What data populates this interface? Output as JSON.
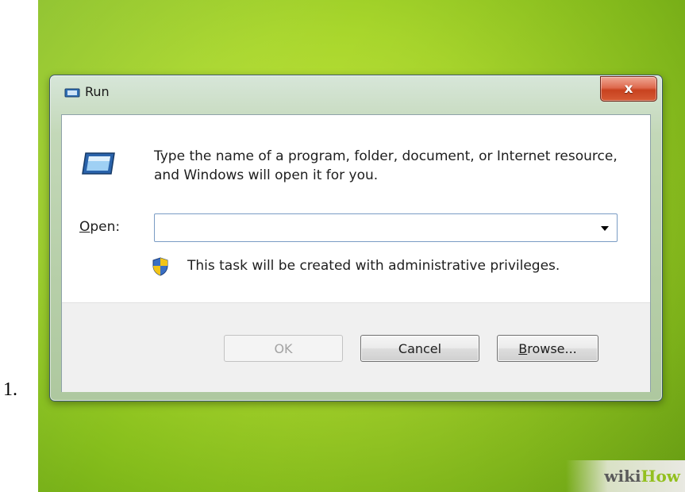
{
  "list_number": "1.",
  "window": {
    "title": "Run",
    "close_glyph": "x"
  },
  "dialog": {
    "message": "Type the name of a program, folder, document, or Internet resource, and Windows will open it for you.",
    "open_label_mnemonic": "O",
    "open_label_rest": "pen:",
    "open_value": "",
    "admin_note": "This task will be created with administrative privileges."
  },
  "buttons": {
    "ok": "OK",
    "cancel": "Cancel",
    "browse_mnemonic": "B",
    "browse_rest": "rowse..."
  },
  "watermark": {
    "part1": "wiki",
    "part2": "How"
  },
  "icons": {
    "title": "run-icon",
    "large": "run-large-icon",
    "shield": "uac-shield-icon",
    "dropdown": "chevron-down-icon"
  },
  "colors": {
    "background": "#a8d62c",
    "close_button": "#c8421f",
    "watermark_how": "#93c01f"
  }
}
